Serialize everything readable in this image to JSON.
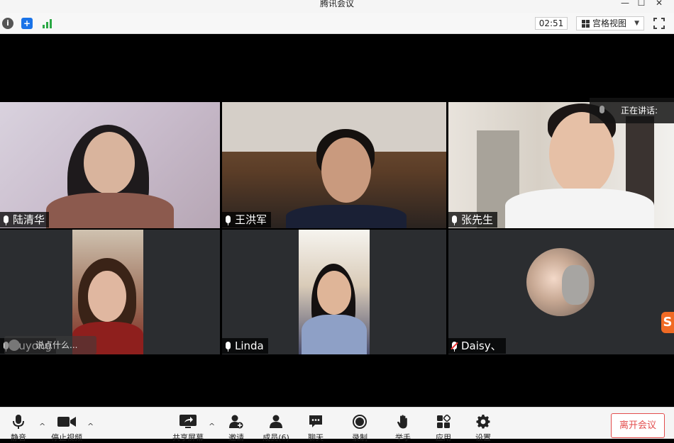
{
  "window": {
    "title": "腾讯会议",
    "minimize": "—",
    "maximize": "☐",
    "close": "✕"
  },
  "toolbar": {
    "info_icon": "info-icon",
    "info_glyph": "i",
    "shield_icon": "shield-icon",
    "shield_glyph": "+",
    "signal_icon": "signal-icon",
    "timer": "02:51",
    "view_label": "宫格视图",
    "view_caret": "▼",
    "fullscreen_icon": "fullscreen-icon"
  },
  "speaking": {
    "label": "正在讲话:"
  },
  "float_input": {
    "text": "说点什么..."
  },
  "participants": [
    {
      "name": "陆清华",
      "muted": false
    },
    {
      "name": "王洪军",
      "muted": false
    },
    {
      "name": "张先生",
      "muted": false
    },
    {
      "name": "liuyong",
      "muted": false
    },
    {
      "name": "Linda",
      "muted": false
    },
    {
      "name": "Daisy、",
      "muted": true
    }
  ],
  "sogou_badge": "S",
  "bottom_bar": {
    "mute": "静音",
    "stop_video": "停止视频",
    "share_screen": "共享屏幕",
    "invite": "邀请",
    "members": "成员(6)",
    "chat": "聊天",
    "record": "录制",
    "raise_hand": "举手",
    "apps": "应用",
    "settings": "设置",
    "leave": "离开会议",
    "arrow": "^"
  },
  "colors": {
    "leave_red": "#e34d4d",
    "signal_green": "#2aa845",
    "shield_blue": "#1a73e8",
    "sogou_orange": "#f06a24"
  }
}
